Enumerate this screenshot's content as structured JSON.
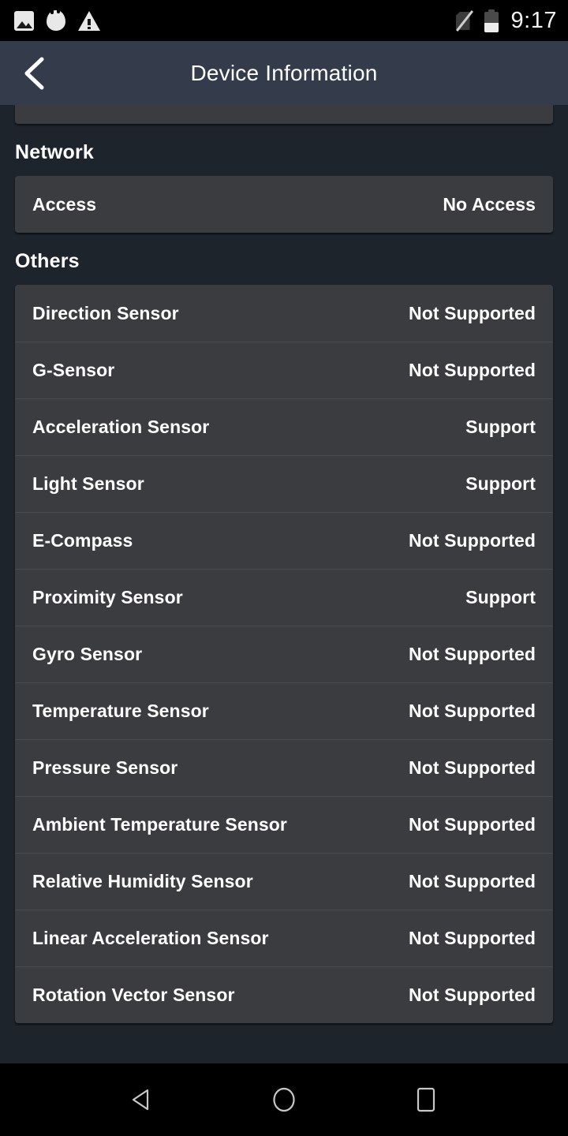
{
  "status_bar": {
    "time": "9:17",
    "icons_left": [
      "photo-icon",
      "flame-icon",
      "warning-icon"
    ],
    "icons_right": [
      "no-sim-icon",
      "battery-icon"
    ],
    "battery_level_percent": 45,
    "background_color": "#000000"
  },
  "app_bar": {
    "title": "Device Information",
    "back_icon": "chevron-left-icon",
    "background_color": "#343c4c"
  },
  "colors": {
    "page_background": "#1e242c",
    "card_background": "#3a3c40",
    "divider": "#4a4c51",
    "text_primary": "#ffffff"
  },
  "content": {
    "sections": [
      {
        "title": "Network",
        "rows": [
          {
            "label": "Access",
            "value": "No Access"
          }
        ]
      },
      {
        "title": "Others",
        "rows": [
          {
            "label": "Direction Sensor",
            "value": "Not Supported"
          },
          {
            "label": "G-Sensor",
            "value": "Not Supported"
          },
          {
            "label": "Acceleration Sensor",
            "value": "Support"
          },
          {
            "label": "Light Sensor",
            "value": "Support"
          },
          {
            "label": "E-Compass",
            "value": "Not Supported"
          },
          {
            "label": "Proximity Sensor",
            "value": "Support"
          },
          {
            "label": "Gyro Sensor",
            "value": "Not Supported"
          },
          {
            "label": "Temperature Sensor",
            "value": "Not Supported"
          },
          {
            "label": "Pressure Sensor",
            "value": "Not Supported"
          },
          {
            "label": "Ambient Temperature Sensor",
            "value": "Not Supported"
          },
          {
            "label": "Relative Humidity Sensor",
            "value": "Not Supported"
          },
          {
            "label": "Linear Acceleration Sensor",
            "value": "Not Supported"
          },
          {
            "label": "Rotation Vector Sensor",
            "value": "Not Supported"
          }
        ]
      }
    ]
  },
  "nav_bar": {
    "buttons": [
      {
        "name": "back",
        "icon": "triangle-left-icon"
      },
      {
        "name": "home",
        "icon": "circle-icon"
      },
      {
        "name": "recents",
        "icon": "square-icon"
      }
    ],
    "background_color": "#000000"
  }
}
